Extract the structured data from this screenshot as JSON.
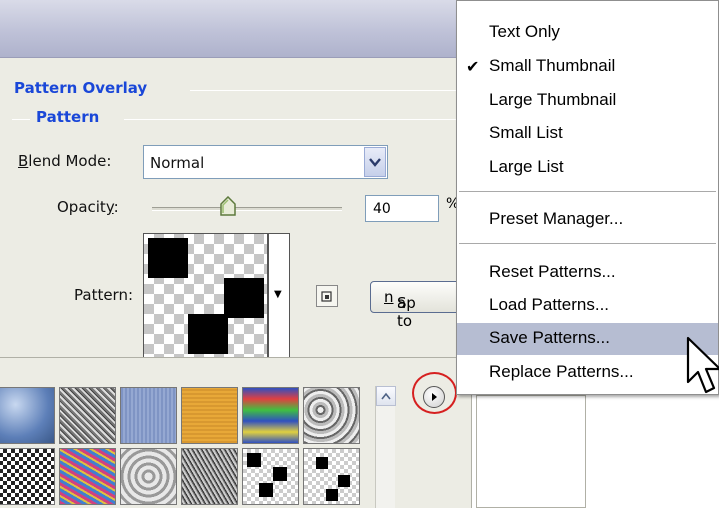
{
  "dialog": {
    "section_title": "Pattern Overlay",
    "subsection_title": "Pattern",
    "blend_mode": {
      "label_prefix": "B",
      "label_rest": "lend Mode:",
      "value": "Normal"
    },
    "opacity": {
      "label_start": "Opacit",
      "label_underline": "y",
      "label_end": ":",
      "value": "40",
      "unit": "%",
      "level_percent": 40
    },
    "pattern_label": "Pattern:",
    "snap_button": {
      "label_start": "S",
      "label_underline": "n",
      "label_end": "ap to"
    }
  },
  "menu": {
    "items": [
      {
        "label": "Text Only",
        "checked": false
      },
      {
        "label": "Small Thumbnail",
        "checked": true
      },
      {
        "label": "Large Thumbnail",
        "checked": false
      },
      {
        "label": "Small List",
        "checked": false
      },
      {
        "label": "Large List",
        "checked": false
      },
      {
        "label": "Preset Manager...",
        "checked": false
      },
      {
        "label": "Reset Patterns...",
        "checked": false
      },
      {
        "label": "Load Patterns...",
        "checked": false
      },
      {
        "label": "Save Patterns...",
        "checked": false,
        "highlighted": true
      },
      {
        "label": "Replace Patterns...",
        "checked": false
      }
    ],
    "check_glyph": "✔"
  },
  "colors": {
    "section_title": "#1a47d8",
    "menu_highlight": "#b6bdd2",
    "callout_circle": "#d62020"
  },
  "icons": {
    "dropdown": "chevron-down-icon",
    "slider": "slider-thumb-icon",
    "new_preset": "new-preset-icon",
    "menu": "flyout-menu-icon",
    "cursor": "mouse-pointer-icon"
  }
}
